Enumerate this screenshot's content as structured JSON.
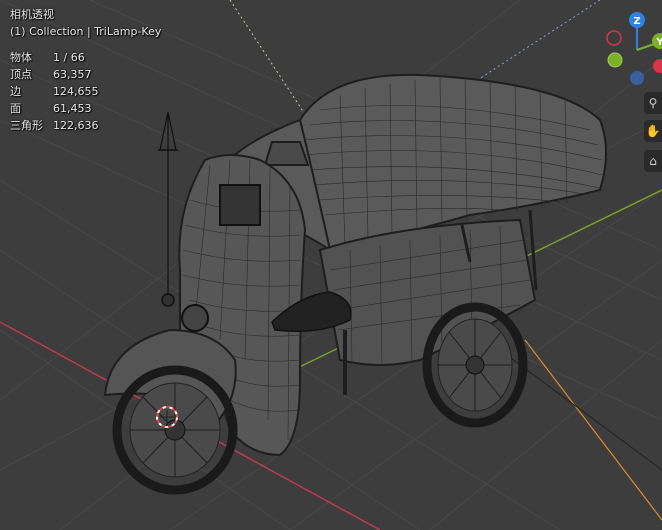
{
  "viewport": {
    "view_name": "相机透视",
    "collection_line": "(1) Collection | TriLamp-Key",
    "stats": [
      {
        "label": "物体",
        "value": "1 / 66"
      },
      {
        "label": "顶点",
        "value": "63,357"
      },
      {
        "label": "边",
        "value": "124,655"
      },
      {
        "label": "面",
        "value": "61,453"
      },
      {
        "label": "三角形",
        "value": "122,636"
      }
    ]
  },
  "gizmo": {
    "z_label": "Z",
    "y_label": "Y",
    "x_color": "#d8334a",
    "y_color": "#7bb02a",
    "z_color": "#2f83e0",
    "neg_color": "#3a5fa0"
  },
  "side_tools": [
    {
      "icon": "zoom-icon",
      "glyph": "⚲"
    },
    {
      "icon": "pan-hand-icon",
      "glyph": "✋"
    },
    {
      "icon": "camera-icon",
      "glyph": "⌂"
    }
  ],
  "colors": {
    "background": "#3d3d3d",
    "grid": "#484848",
    "x_axis": "#c43a52",
    "y_axis": "#7aa32b",
    "wire": "#1e1e1e",
    "mesh": "#5a5a5a"
  }
}
